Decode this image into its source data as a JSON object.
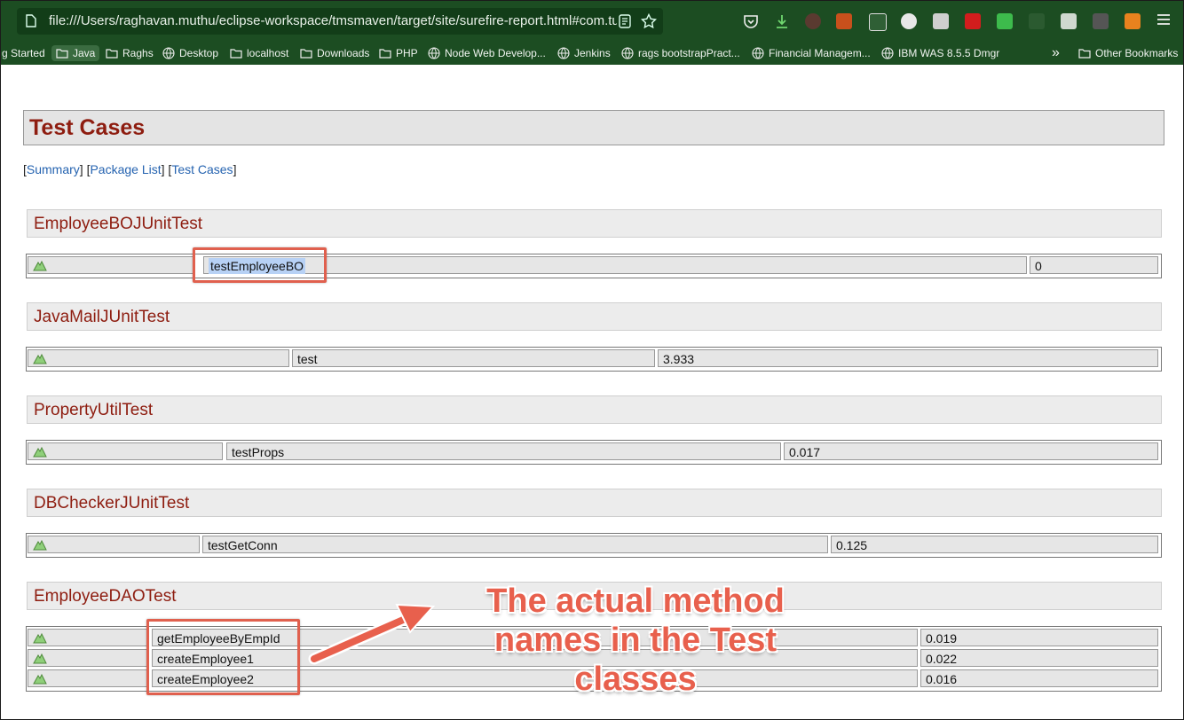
{
  "browser": {
    "url": "file:///Users/raghavan.muthu/eclipse-workspace/tmsmaven/target/site/surefire-report.html#com.tu",
    "bookmarks": [
      {
        "label": "g Started",
        "type": "none"
      },
      {
        "label": "Java",
        "type": "folder",
        "active": true
      },
      {
        "label": "Raghs",
        "type": "folder"
      },
      {
        "label": "Desktop",
        "type": "globe"
      },
      {
        "label": "localhost",
        "type": "folder"
      },
      {
        "label": "Downloads",
        "type": "folder"
      },
      {
        "label": "PHP",
        "type": "folder"
      },
      {
        "label": "Node Web Develop...",
        "type": "globe"
      },
      {
        "label": "Jenkins",
        "type": "globe"
      },
      {
        "label": "rags bootstrapPract...",
        "type": "globe"
      },
      {
        "label": "Financial Managem...",
        "type": "globe"
      },
      {
        "label": "IBM WAS 8.5.5 Dmgr",
        "type": "globe"
      }
    ],
    "overflow_label": "»",
    "other_bookmarks": "Other Bookmarks",
    "colors": {
      "toolbar": "#1c4d22",
      "urlbar": "#123d18"
    }
  },
  "page": {
    "title": "Test Cases",
    "nav": {
      "summary": "Summary",
      "package_list": "Package List",
      "test_cases": "Test Cases",
      "open": "[",
      "close": "]"
    },
    "sections": [
      {
        "name": "EmployeeBOJUnitTest",
        "rows": [
          {
            "method": "testEmployeeBO",
            "time": "0"
          }
        ]
      },
      {
        "name": "JavaMailJUnitTest",
        "rows": [
          {
            "method": "test",
            "time": "3.933"
          }
        ]
      },
      {
        "name": "PropertyUtilTest",
        "rows": [
          {
            "method": "testProps",
            "time": "0.017"
          }
        ]
      },
      {
        "name": "DBCheckerJUnitTest",
        "rows": [
          {
            "method": "testGetConn",
            "time": "0.125"
          }
        ]
      },
      {
        "name": "EmployeeDAOTest",
        "rows": [
          {
            "method": "getEmployeeByEmpId",
            "time": "0.019"
          },
          {
            "method": "createEmployee1",
            "time": "0.022"
          },
          {
            "method": "createEmployee2",
            "time": "0.016"
          }
        ]
      }
    ],
    "status_icon": "success-icon",
    "heading_color": "#8e1d10"
  },
  "annotation": {
    "callout_lines": [
      "The actual method",
      "names in the Test",
      "classes"
    ],
    "color": "#e8604d"
  }
}
